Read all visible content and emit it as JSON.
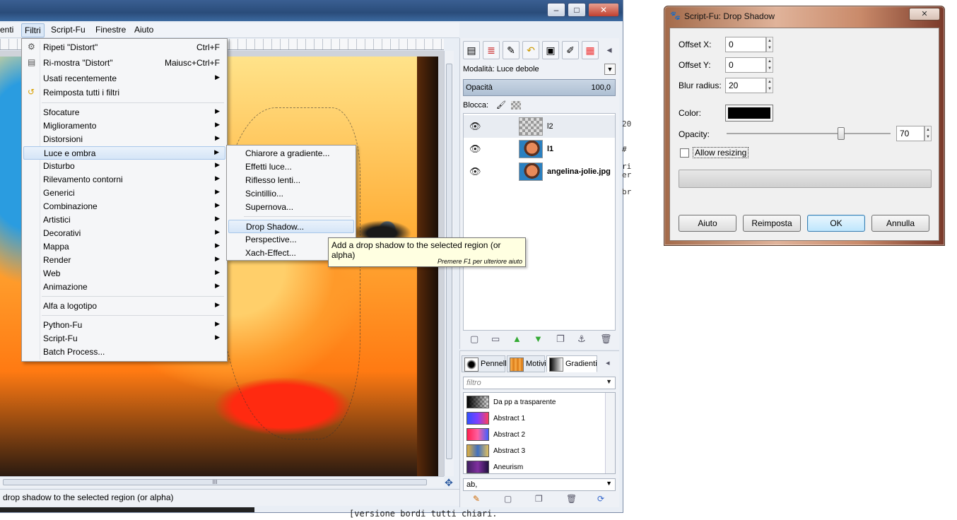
{
  "gimp": {
    "menubar": [
      {
        "label": "enti"
      },
      {
        "label": "Filtri"
      },
      {
        "label": "Script-Fu"
      },
      {
        "label": "Finestre"
      },
      {
        "label": "Aiuto"
      }
    ],
    "window_buttons": [
      "–",
      "□",
      "✕"
    ],
    "status_text": "drop shadow to the selected region (or alpha)",
    "hscroll_grip": "III"
  },
  "filters_menu": {
    "items": [
      {
        "label": "Ripeti \"Distort\"",
        "shortcut": "Ctrl+F",
        "icon": "repeat-icon"
      },
      {
        "label": "Ri-mostra \"Distort\"",
        "shortcut": "Maiusc+Ctrl+F",
        "icon": "reshow-icon"
      },
      {
        "label": "Usati recentemente",
        "arrow": "▶"
      },
      {
        "label": "Reimposta tutti i filtri",
        "icon": "reset-icon"
      },
      {
        "label": "Sfocature",
        "arrow": "▶"
      },
      {
        "label": "Miglioramento",
        "arrow": "▶"
      },
      {
        "label": "Distorsioni",
        "arrow": "▶"
      },
      {
        "label": "Luce e ombra",
        "arrow": "▶"
      },
      {
        "label": "Disturbo",
        "arrow": "▶"
      },
      {
        "label": "Rilevamento contorni",
        "arrow": "▶"
      },
      {
        "label": "Generici",
        "arrow": "▶"
      },
      {
        "label": "Combinazione",
        "arrow": "▶"
      },
      {
        "label": "Artistici",
        "arrow": "▶"
      },
      {
        "label": "Decorativi",
        "arrow": "▶"
      },
      {
        "label": "Mappa",
        "arrow": "▶"
      },
      {
        "label": "Render",
        "arrow": "▶"
      },
      {
        "label": "Web",
        "arrow": "▶"
      },
      {
        "label": "Animazione",
        "arrow": "▶"
      },
      {
        "label": "Alfa a logotipo",
        "arrow": "▶"
      },
      {
        "label": "Python-Fu",
        "arrow": "▶"
      },
      {
        "label": "Script-Fu",
        "arrow": "▶"
      },
      {
        "label": "Batch Process..."
      }
    ]
  },
  "light_shadow_submenu": {
    "items": [
      {
        "label": "Chiarore a gradiente..."
      },
      {
        "label": "Effetti luce..."
      },
      {
        "label": "Riflesso lenti..."
      },
      {
        "label": "Scintillio..."
      },
      {
        "label": "Supernova..."
      },
      {
        "label": "Drop Shadow..."
      },
      {
        "label": "Perspective..."
      },
      {
        "label": "Xach-Effect..."
      }
    ]
  },
  "tooltip": {
    "text": "Add a drop shadow to the selected region (or alpha)",
    "hint": "Premere F1 per ulteriore aiuto"
  },
  "layers_dock": {
    "mode_label": "Modalità:  Luce debole",
    "opacity_label": "Opacità",
    "opacity_value": "100,0",
    "lock_label": "Blocca:",
    "layers": [
      {
        "name": "l2"
      },
      {
        "name": "l1"
      },
      {
        "name": "angelina-jolie.jpg"
      }
    ]
  },
  "brushes_dock": {
    "tabs": [
      {
        "label": "Pennelli"
      },
      {
        "label": "Motivi"
      },
      {
        "label": "Gradienti"
      }
    ],
    "filter_placeholder": "filtro",
    "gradients": [
      {
        "name": "Da pp a trasparente"
      },
      {
        "name": "Abstract 1"
      },
      {
        "name": "Abstract 2"
      },
      {
        "name": "Abstract 3"
      },
      {
        "name": "Aneurism"
      }
    ],
    "tag_value": "ab,"
  },
  "script_dialog": {
    "title": "Script-Fu: Drop Shadow",
    "fields": {
      "offset_x_label": "Offset X:",
      "offset_x_value": "0",
      "offset_y_label": "Offset Y:",
      "offset_y_value": "0",
      "blur_label": "Blur radius:",
      "blur_value": "20",
      "color_label": "Color:",
      "color_value": "#000000",
      "opacity_label": "Opacity:",
      "opacity_value": "70",
      "opacity_fraction": 0.7,
      "resize_label": "Allow resizing",
      "resize_checked": false
    },
    "buttons": {
      "help": "Aiuto",
      "reset": "Reimposta",
      "ok": "OK",
      "cancel": "Annulla"
    },
    "close_glyph": "✕"
  },
  "background_text": {
    "side_lines": [
      "20",
      "",
      "#",
      "",
      "ri",
      "er",
      "",
      "br"
    ],
    "bottom_line": "[versione bordi tutti chiari."
  }
}
